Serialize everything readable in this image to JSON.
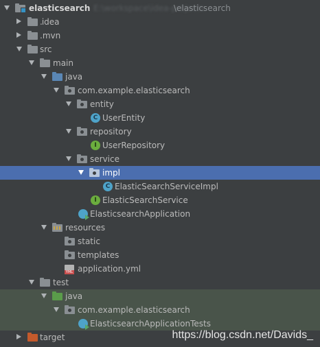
{
  "tree": {
    "root": {
      "label": "elasticsearch",
      "path_hidden": "E:\\workspace\\idea-projects",
      "path_suffix": "\\elasticsearch"
    },
    "idea": "idea",
    "mvn": ".mvn",
    "src": "src",
    "main": "main",
    "java_main": "java",
    "pkg_main": "com.example.elasticsearch",
    "entity": "entity",
    "user_entity": "UserEntity",
    "repository": "repository",
    "user_repository": "UserRepository",
    "service": "service",
    "impl": "impl",
    "service_impl": "ElasticSearchServiceImpl",
    "service_iface": "ElasticSearchService",
    "app": "ElasticsearchApplication",
    "resources": "resources",
    "static": "static",
    "templates": "templates",
    "app_yml": "application.yml",
    "test": "test",
    "java_test": "java",
    "pkg_test": "com.example.elasticsearch",
    "app_tests": "ElasticsearchApplicationTests",
    "target": "target"
  },
  "icons": {
    "class_letter": "C",
    "interface_letter": "I",
    "yml_badge": "YML"
  },
  "watermark": "https://blog.csdn.net/Davids_"
}
